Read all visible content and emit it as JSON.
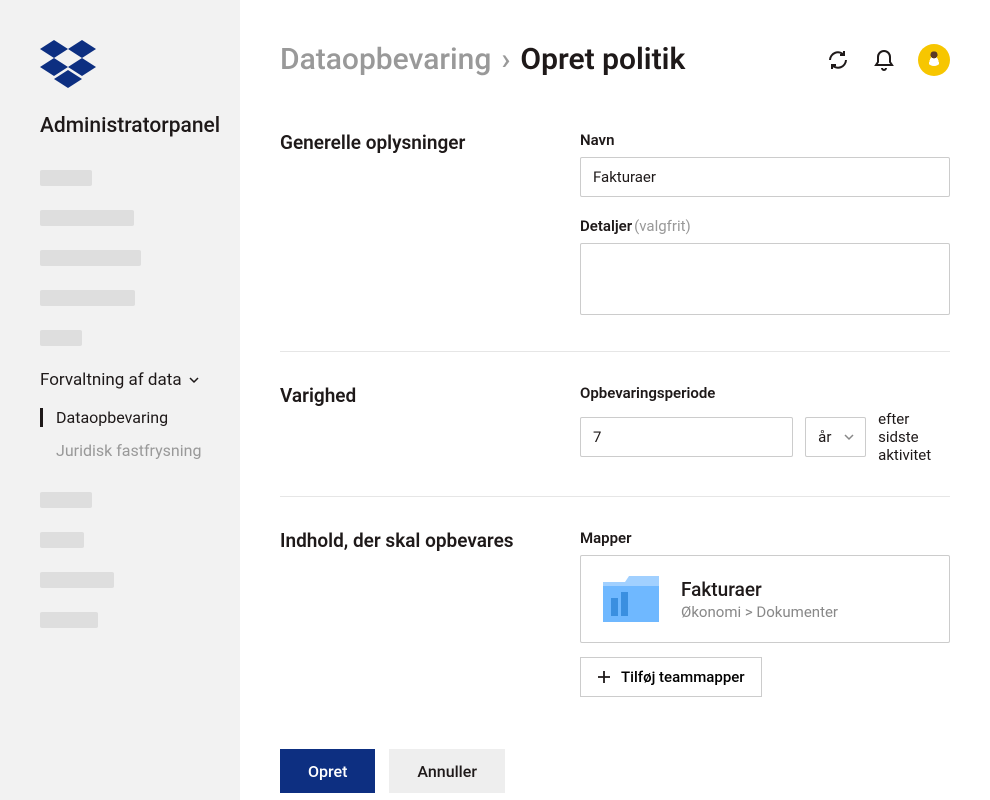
{
  "sidebar": {
    "panel_title": "Administratorpanel",
    "section_label": "Forvaltning af data",
    "subnav": [
      {
        "label": "Dataopbevaring",
        "active": true
      },
      {
        "label": "Juridisk fastfrysning",
        "active": false
      }
    ]
  },
  "header": {
    "breadcrumb_parent": "Dataopbevaring",
    "breadcrumb_current": "Opret politik"
  },
  "form": {
    "general": {
      "section": "Generelle oplysninger",
      "name_label": "Navn",
      "name_value": "Fakturaer",
      "details_label": "Detaljer",
      "details_optional": "(valgfrit)",
      "details_value": ""
    },
    "duration": {
      "section": "Varighed",
      "period_label": "Opbevaringsperiode",
      "period_value": "7",
      "period_unit": "år",
      "after_text": "efter sidste aktivitet"
    },
    "content": {
      "section": "Indhold, der skal opbevares",
      "folders_label": "Mapper",
      "folder_name": "Fakturaer",
      "folder_path": "Økonomi > Dokumenter",
      "add_button": "Tilføj teammapper"
    }
  },
  "actions": {
    "create": "Opret",
    "cancel": "Annuller"
  }
}
